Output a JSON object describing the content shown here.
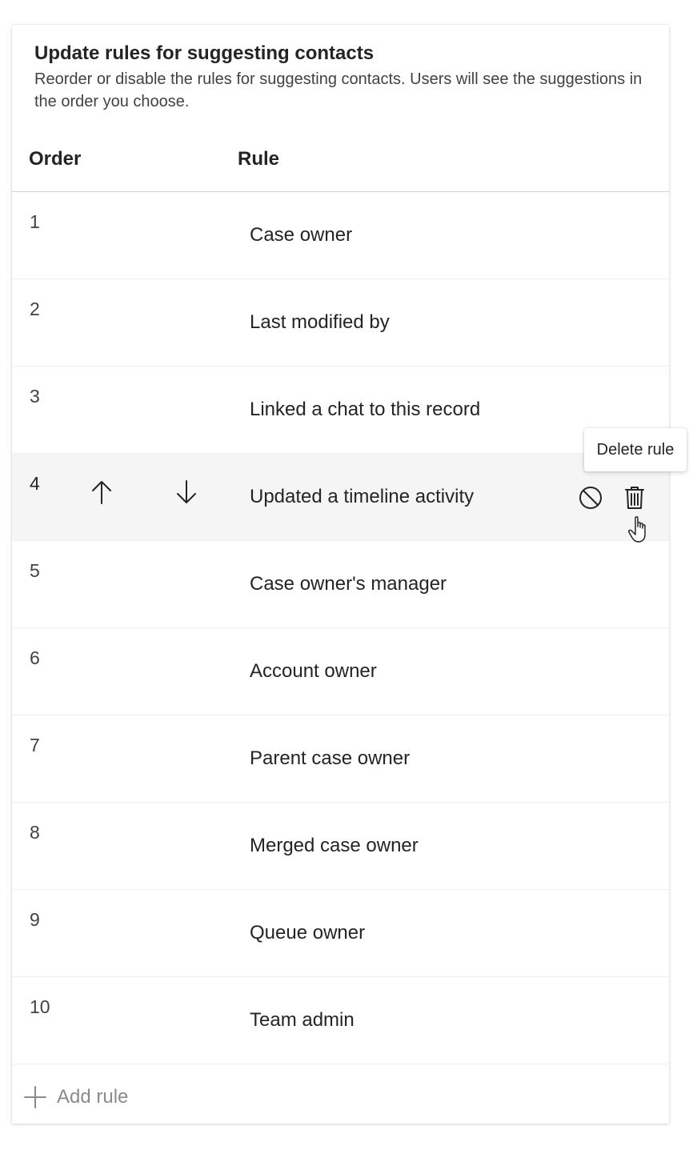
{
  "header": {
    "title": "Update rules for suggesting contacts",
    "subtitle": "Reorder or disable the rules for suggesting contacts. Users will see the suggestions in the order you choose."
  },
  "columns": {
    "order": "Order",
    "rule": "Rule"
  },
  "rows": [
    {
      "order": "1",
      "rule": "Case owner"
    },
    {
      "order": "2",
      "rule": "Last modified by"
    },
    {
      "order": "3",
      "rule": "Linked a chat to this record"
    },
    {
      "order": "4",
      "rule": "Updated a timeline activity"
    },
    {
      "order": "5",
      "rule": "Case owner's manager"
    },
    {
      "order": "6",
      "rule": "Account owner"
    },
    {
      "order": "7",
      "rule": "Parent case owner"
    },
    {
      "order": "8",
      "rule": "Merged case owner"
    },
    {
      "order": "9",
      "rule": "Queue owner"
    },
    {
      "order": "10",
      "rule": "Team admin"
    }
  ],
  "hovered_row_icons": [
    "arrow-up-icon",
    "arrow-down-icon",
    "disable-icon",
    "delete-icon"
  ],
  "tooltip": {
    "text": "Delete rule"
  },
  "add_rule": {
    "label": "Add rule",
    "icon": "plus-icon"
  },
  "colors": {
    "hover_row": "#f5f5f5",
    "text": "#242424",
    "muted": "#8a8a8a"
  }
}
